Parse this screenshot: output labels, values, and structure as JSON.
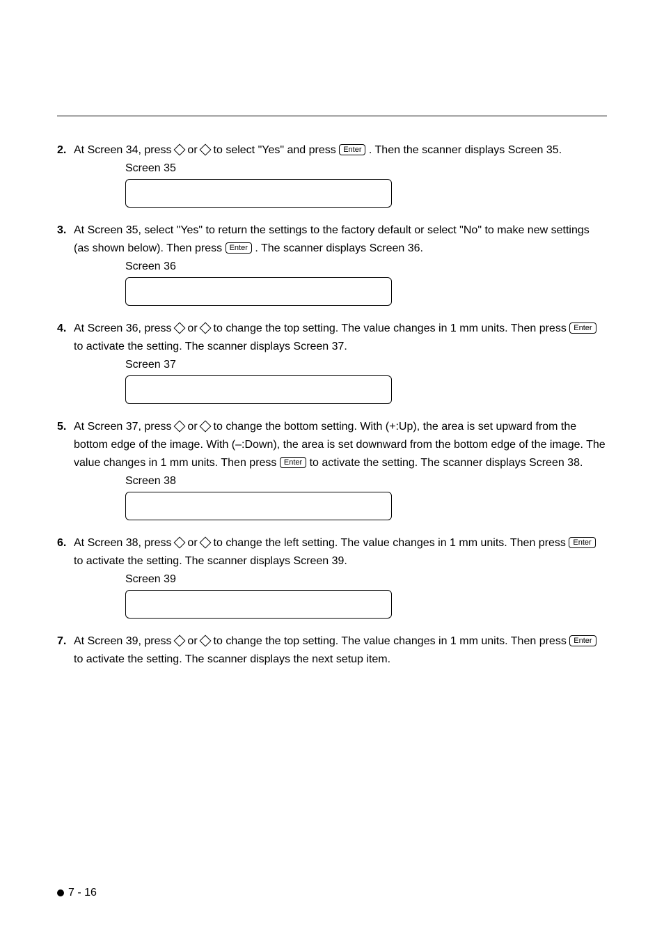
{
  "steps": [
    {
      "num": "2.",
      "html_parts": [
        "At Screen 34, press ",
        {
          "icon": "diamond"
        },
        " or ",
        {
          "icon": "diamond"
        },
        " to select \"Yes\" and press ",
        {
          "icon": "enter"
        },
        " . Then the scanner displays Screen 35."
      ],
      "screen_label": "Screen 35"
    },
    {
      "num": "3.",
      "html_parts": [
        "At Screen 35, select \"Yes\" to return the settings to the factory default or select \"No\" to make new settings (as shown below). Then press ",
        {
          "icon": "enter"
        },
        " . The scanner displays Screen 36."
      ],
      "screen_label": "Screen 36"
    },
    {
      "num": "4.",
      "html_parts": [
        "At Screen 36, press ",
        {
          "icon": "diamond"
        },
        " or ",
        {
          "icon": "diamond"
        },
        " to change the top setting. The value changes in 1 mm units. Then press ",
        {
          "icon": "enter"
        },
        " to activate the setting. The scanner displays Screen 37."
      ],
      "screen_label": "Screen 37"
    },
    {
      "num": "5.",
      "html_parts": [
        "At Screen 37, press ",
        {
          "icon": "diamond"
        },
        " or ",
        {
          "icon": "diamond"
        },
        " to change the bottom setting. With (+:Up), the area is set upward from the bottom edge of the image. With (–:Down), the area is set downward from the bottom edge of the image. The value changes in 1 mm units. Then press ",
        {
          "icon": "enter"
        },
        " to activate the setting. The scanner displays Screen 38."
      ],
      "screen_label": "Screen 38"
    },
    {
      "num": "6.",
      "html_parts": [
        "At Screen 38, press ",
        {
          "icon": "diamond"
        },
        " or ",
        {
          "icon": "diamond"
        },
        " to change the left setting. The value changes in 1 mm units. Then press ",
        {
          "icon": "enter"
        },
        " to activate the setting. The scanner displays Screen 39."
      ],
      "screen_label": "Screen 39"
    },
    {
      "num": "7.",
      "html_parts": [
        "At Screen 39, press ",
        {
          "icon": "diamond"
        },
        " or ",
        {
          "icon": "diamond"
        },
        " to change the top setting. The value changes in 1 mm units. Then press ",
        {
          "icon": "enter"
        },
        " to activate the setting. The scanner displays the next setup item."
      ],
      "screen_label": null
    }
  ],
  "enter_key_label": "Enter",
  "page_number": "7 - 16"
}
